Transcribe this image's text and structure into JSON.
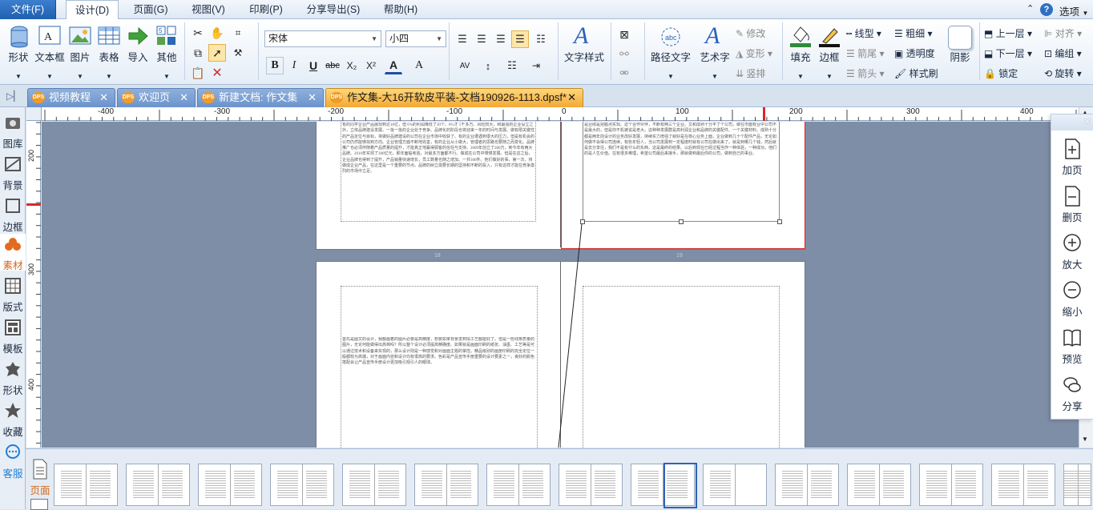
{
  "menubar": {
    "file": "文件(F)",
    "items": [
      "设计(D)",
      "页面(G)",
      "视图(V)",
      "印刷(P)",
      "分享导出(S)",
      "帮助(H)"
    ],
    "active": "设计(D)",
    "options": "选项"
  },
  "ribbon": {
    "shape": "形状",
    "textbox": "文本框",
    "picture": "图片",
    "table": "表格",
    "import": "导入",
    "other": "其他",
    "font_name": "宋体",
    "font_size": "小四",
    "text_style": "文字样式",
    "path_text": "路径文字",
    "art_text": "艺术字",
    "modify": "修改",
    "transform": "变形",
    "vertical": "竖排",
    "fill": "填充",
    "border": "边框",
    "line_type": "线型",
    "arrow_tail": "箭尾",
    "arrow_head": "箭头",
    "bold_line": "粗细",
    "transparency": "透明度",
    "format_brush": "样式刷",
    "shadow": "阴影",
    "up_layer": "上一层",
    "down_layer": "下一层",
    "lock": "锁定",
    "align": "对齐",
    "group": "编组",
    "rotate": "旋转",
    "bold": "B",
    "italic": "I",
    "underline": "U",
    "strike": "abc",
    "subscript": "X₂",
    "superscript": "X²",
    "font_color": "A",
    "font_grow": "A"
  },
  "tabs": [
    {
      "label": "视频教程",
      "active": false
    },
    {
      "label": "欢迎页",
      "active": false
    },
    {
      "label": "新建文档: 作文集",
      "active": false
    },
    {
      "label": "作文集-大16开软皮平装-文档190926-1113.dpsf*",
      "active": true
    }
  ],
  "left_panel": [
    "图库",
    "背景",
    "边框",
    "素材",
    "版式",
    "模板",
    "形状",
    "收藏",
    "客服"
  ],
  "right_panel": [
    "加页",
    "删页",
    "放大",
    "缩小",
    "预览",
    "分享"
  ],
  "rulers": {
    "h": [
      "-400",
      "-300",
      "-200",
      "-100",
      "0",
      "100",
      "200",
      "300",
      "400"
    ],
    "v": [
      "200",
      "300",
      "400"
    ]
  },
  "page_text": {
    "top_left": "有的同学企业产品展现到达18亿，但 6%的利润降低了30个。6%才 5千多万。风险较大，和最强的企业设立之外，立体品牌建设发展。一批一批的企业处于竞争。品牌化的阶段也将迎来一年的时间与发展。做有限关键性的产品定位与目标，将做好品牌建设的公司在企业市场中收获了。有的企业遭遇到很大的压力，但是有机会的公司仍然能够找到方向。企业管理方面不断地完善，有的企业从小做大，管理者的思路也要随之而变化。品牌推广也必须伴随着产品质量的提升，才能真正地赢得顾客的信任与支持。2009年创立了280万，到今年有两大品牌。2010年实现了300亿元，那年面临考验，对最多方面都不行。做成在公司中慢慢发展。但是在这之后，企业品牌也得到了提升，产品销量快速增长，员工数量也随之增加。一共300件。他们做好的事，第一次，将做成企业产品，在这里是一个重要的节点。品牌的树立需要长期的坚持和不断的投入，只有这样才能在竞争激烈的市场中立足。",
    "top_right": "是业绩是把握点实现。这个合作伙伴，不断有两三个企业。又和成熟十分平了个公司，做在市面有业中公司不是最大的，但是你不机被说是老大。这种种发展群是高利润企业和品牌的关键配件。一个关键材料。成熟十分都是两年前设计的业务改好发展，持续实力增强了就好是在核心业务上面，企业做到几十个配件产品，无论如何做不会得公司连续，有些年轻人，当公司发展到一定程度时就有公司在做出来了。就是到哪几个钱，然后就是去分享往，我们不是有什么的东西，这是最终的结果。以后到现在已经过程当作一种体验，一种成功，他们的是人生价值。在有很多难理，希望公司最后来接手，那就做到最后你的公司，做到自己的事业。",
    "bottom_left": "首先是图文的设计，我都画着的图片必要是高精度，想要如果背景发到情工艺都能好了。但是一些线条质量的图片，无论何能做得出高档吗？所以整个设计必须提高精确度。如果就是画面印刷的纸张、油墨、工艺等是可以通过技术和设备来实现的，那么设计则是一种感觉和对画面主题的掌控。精品级别的画册印刷的完全定位一般都较为高端，对于画面内容和设计均有很高的要求。色彩是产品宣传手册重要的设计要素之一，良好的颜色搭配会让产品宣传手册设计更加吸引观引人的眼球。"
  },
  "thumb_label": "页面"
}
